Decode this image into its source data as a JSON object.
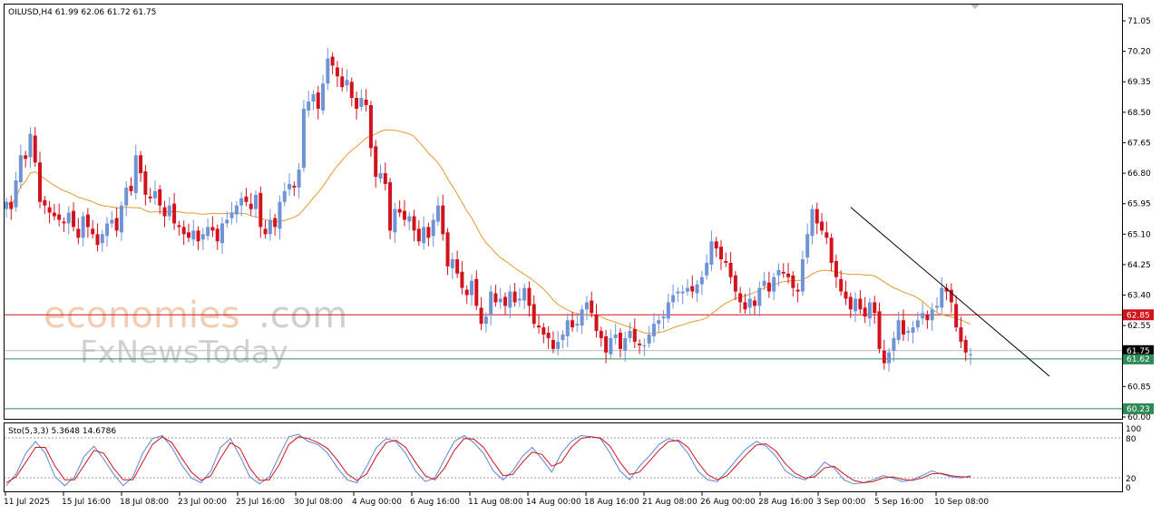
{
  "chart_info": {
    "title": "OILUSD,H4  61.99 62.06 61.72 61.75",
    "stoch_label": "Sto(5,3,3) 5.3648 14.6786"
  },
  "watermark": {
    "part1": "economies",
    "part2": ".com",
    "line2": "FxNewsToday"
  },
  "colors": {
    "bull": "#6f94d6",
    "bear": "#d0131c",
    "ma": "#e39a2e",
    "resistance": "#d0131c",
    "support": "#2e8b57",
    "trendline": "#000000",
    "stoch_main": "#5b86d6",
    "stoch_signal": "#d0131c"
  },
  "chart_data": {
    "type": "candlestick",
    "symbol": "OILUSD",
    "timeframe": "H4",
    "ylim": [
      60.0,
      71.4
    ],
    "y_ticks": [
      "71.05",
      "70.20",
      "69.35",
      "68.50",
      "67.65",
      "66.80",
      "65.95",
      "65.10",
      "64.25",
      "63.40",
      "62.55",
      "61.75",
      "60.85",
      "60.00"
    ],
    "x_ticks": [
      "11 Jul 2025",
      "15 Jul 16:00",
      "18 Jul 08:00",
      "23 Jul 00:00",
      "25 Jul 16:00",
      "30 Jul 08:00",
      "4 Aug 00:00",
      "6 Aug 16:00",
      "11 Aug 08:00",
      "14 Aug 00:00",
      "18 Aug 16:00",
      "21 Aug 08:00",
      "26 Aug 00:00",
      "28 Aug 16:00",
      "3 Sep 00:00",
      "5 Sep 16:00",
      "10 Sep 08:00"
    ],
    "levels": [
      {
        "label": "62.85",
        "value": 62.85,
        "kind": "resistance"
      },
      {
        "label": "61.62",
        "value": 61.62,
        "kind": "support"
      },
      {
        "label": "60.23",
        "value": 60.23,
        "kind": "support"
      }
    ],
    "current_price": {
      "label": "61.75",
      "value": 61.75
    },
    "trendline": {
      "start_close_index": 176,
      "start_value": 65.85,
      "end_value": 62.15
    },
    "closes": [
      66.0,
      65.8,
      66.6,
      67.3,
      67.2,
      67.9,
      67.1,
      66.0,
      65.9,
      65.7,
      65.6,
      65.5,
      65.4,
      65.7,
      65.3,
      65.0,
      65.6,
      65.3,
      65.1,
      64.8,
      65.1,
      65.4,
      65.5,
      65.2,
      65.9,
      66.4,
      66.3,
      67.3,
      66.8,
      66.2,
      66.1,
      66.3,
      65.9,
      65.6,
      65.9,
      65.4,
      65.3,
      65.1,
      65.0,
      65.2,
      64.9,
      65.1,
      65.3,
      65.2,
      64.9,
      65.4,
      65.5,
      65.7,
      65.9,
      66.1,
      66.0,
      65.8,
      66.2,
      65.3,
      65.1,
      65.5,
      65.3,
      66.0,
      66.3,
      66.5,
      66.4,
      66.9,
      68.6,
      68.8,
      69.0,
      68.6,
      69.3,
      70.0,
      69.8,
      69.5,
      69.2,
      69.4,
      68.9,
      68.6,
      68.9,
      68.7,
      67.5,
      66.7,
      66.8,
      66.5,
      65.2,
      65.8,
      65.7,
      65.5,
      65.6,
      65.2,
      64.9,
      65.3,
      65.0,
      65.5,
      65.9,
      65.1,
      64.2,
      64.4,
      64.0,
      63.6,
      63.4,
      63.8,
      63.1,
      62.6,
      62.8,
      63.5,
      63.2,
      63.3,
      63.1,
      63.5,
      63.2,
      63.3,
      63.6,
      63.1,
      62.6,
      62.5,
      62.3,
      62.2,
      61.9,
      62.1,
      62.3,
      62.7,
      62.5,
      62.6,
      63.0,
      63.2,
      62.9,
      62.4,
      62.2,
      61.8,
      62.2,
      62.3,
      61.9,
      62.2,
      62.4,
      62.1,
      62.0,
      62.0,
      62.3,
      62.6,
      62.7,
      62.8,
      63.2,
      63.4,
      63.5,
      63.5,
      63.6,
      63.5,
      63.7,
      63.9,
      64.3,
      64.9,
      64.7,
      64.4,
      64.3,
      63.9,
      63.5,
      63.2,
      63.0,
      63.3,
      63.1,
      63.6,
      63.8,
      63.5,
      63.9,
      64.1,
      64.0,
      63.9,
      63.6,
      63.5,
      64.4,
      65.1,
      65.8,
      65.4,
      65.2,
      65.0,
      64.3,
      63.9,
      63.5,
      63.3,
      63.0,
      63.3,
      63.0,
      62.8,
      63.2,
      62.9,
      61.9,
      61.5,
      61.8,
      62.2,
      62.7,
      62.3,
      62.4,
      62.5,
      62.7,
      62.9,
      62.7,
      63.0,
      63.1,
      63.6,
      63.5,
      63.2,
      62.5,
      62.1,
      61.8,
      61.75
    ]
  },
  "stochastic": {
    "levels": [
      "100",
      "80",
      "20",
      "0"
    ],
    "k": [
      5,
      25,
      60,
      80,
      60,
      20,
      5,
      20,
      55,
      72,
      50,
      25,
      5,
      20,
      60,
      85,
      90,
      70,
      40,
      18,
      10,
      30,
      70,
      85,
      55,
      20,
      8,
      20,
      55,
      88,
      92,
      80,
      75,
      60,
      35,
      15,
      10,
      38,
      70,
      85,
      80,
      60,
      30,
      12,
      18,
      50,
      80,
      90,
      78,
      60,
      30,
      15,
      30,
      55,
      70,
      50,
      28,
      60,
      80,
      90,
      88,
      85,
      60,
      30,
      15,
      38,
      55,
      75,
      85,
      80,
      60,
      30,
      15,
      12,
      30,
      50,
      68,
      80,
      72,
      55,
      30,
      20,
      15,
      25,
      45,
      35,
      15,
      8,
      10,
      15,
      22,
      18,
      12,
      15,
      22,
      30,
      25,
      20,
      18,
      22
    ],
    "d": [
      10,
      20,
      45,
      70,
      70,
      38,
      15,
      15,
      40,
      65,
      60,
      35,
      15,
      15,
      45,
      75,
      88,
      78,
      52,
      28,
      14,
      22,
      52,
      78,
      68,
      35,
      14,
      15,
      40,
      75,
      88,
      85,
      78,
      68,
      48,
      25,
      14,
      25,
      55,
      78,
      82,
      70,
      45,
      22,
      15,
      35,
      65,
      85,
      84,
      70,
      45,
      22,
      24,
      45,
      62,
      58,
      38,
      45,
      70,
      85,
      88,
      86,
      72,
      45,
      24,
      28,
      46,
      65,
      80,
      82,
      70,
      45,
      24,
      15,
      22,
      40,
      58,
      74,
      76,
      64,
      42,
      26,
      18,
      20,
      35,
      38,
      25,
      14,
      10,
      12,
      18,
      20,
      16,
      14,
      18,
      25,
      26,
      22,
      20,
      20
    ]
  }
}
